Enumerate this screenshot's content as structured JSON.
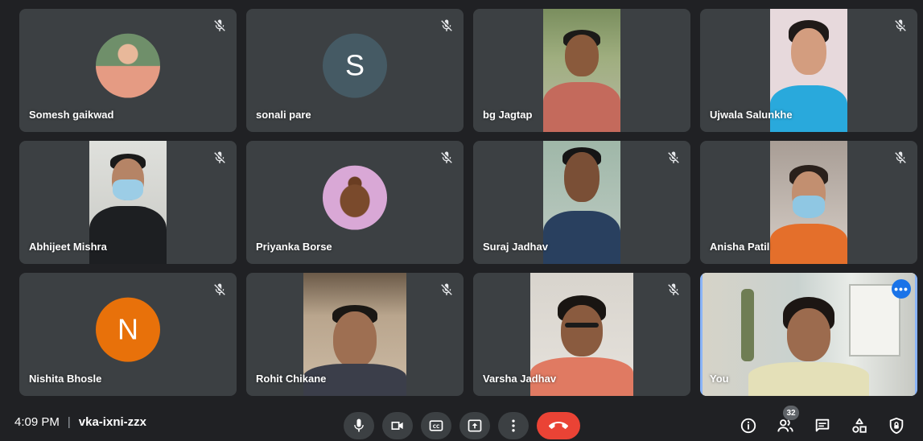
{
  "participants": [
    {
      "name": "Somesh gaikwad",
      "tile": "avatar-photo"
    },
    {
      "name": "sonali pare",
      "tile": "avatar-letter",
      "initial": "S",
      "avatar_color": "#455a64"
    },
    {
      "name": "bg Jagtap",
      "tile": "video"
    },
    {
      "name": "Ujwala Salunkhe",
      "tile": "video"
    },
    {
      "name": "Abhijeet Mishra",
      "tile": "video"
    },
    {
      "name": "Priyanka Borse",
      "tile": "avatar-photo"
    },
    {
      "name": "Suraj Jadhav",
      "tile": "video"
    },
    {
      "name": "Anisha Patil",
      "tile": "video"
    },
    {
      "name": "Nishita Bhosle",
      "tile": "avatar-letter",
      "initial": "N",
      "avatar_color": "#e8710a"
    },
    {
      "name": "Rohit Chikane",
      "tile": "video"
    },
    {
      "name": "Varsha Jadhav",
      "tile": "video"
    },
    {
      "name": "You",
      "tile": "video-self"
    }
  ],
  "bottombar": {
    "time": "4:09 PM",
    "separator": "|",
    "meeting_code": "vka-ixni-zzx",
    "people_count": "32"
  },
  "icons": {
    "muted": "mic-off-icon",
    "mic": "mic-icon",
    "camera": "videocam-icon",
    "captions": "cc-icon",
    "present": "present-icon",
    "more": "more-vert-icon",
    "hangup": "call-end-icon",
    "info": "info-icon",
    "people": "people-icon",
    "chat": "chat-icon",
    "activities": "activities-icon",
    "host_controls": "shield-lock-icon"
  },
  "colors": {
    "background": "#202124",
    "tile": "#3c4043",
    "hangup": "#ea4335",
    "self_outline": "#8ab4f8",
    "accent": "#1a73e8"
  }
}
